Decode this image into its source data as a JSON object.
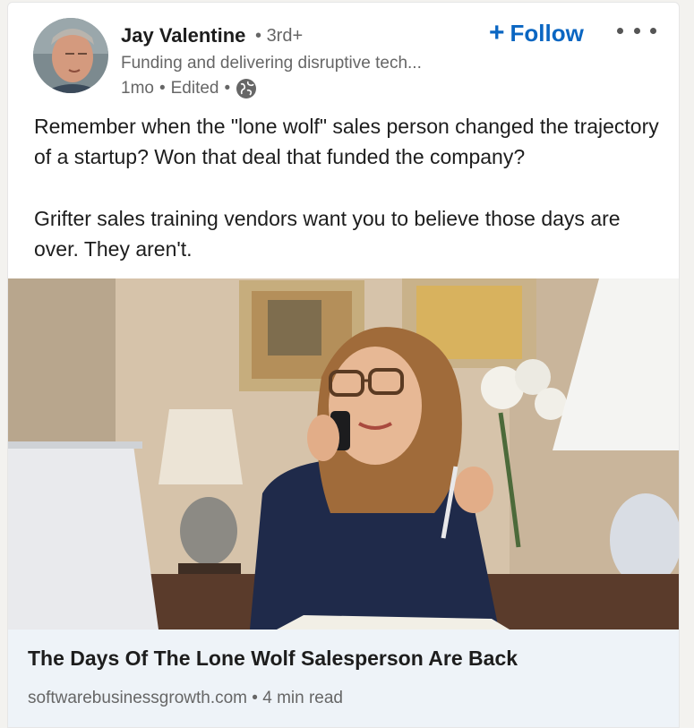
{
  "author": {
    "name": "Jay Valentine",
    "degree": "3rd+",
    "headline": "Funding and delivering disruptive tech...",
    "posted": "1mo",
    "edited": "Edited",
    "visibility_icon": "globe-icon"
  },
  "actions": {
    "follow_label": "Follow",
    "more_icon": "more-horizontal-icon"
  },
  "post": {
    "paragraphs": [
      "Remember when the \"lone wolf\" sales person changed the trajectory of a startup? Won that deal that funded the company?",
      "Grifter sales training vendors want you to believe those days are over. They aren't."
    ]
  },
  "article": {
    "title": "The Days Of The Lone Wolf Salesperson Are Back",
    "source": "softwarebusinessgrowth.com",
    "read_time": "4 min read"
  },
  "colors": {
    "accent": "#0a66c2",
    "text": "#1d1d1d",
    "muted": "#666666",
    "link_bg": "#eef3f8"
  }
}
